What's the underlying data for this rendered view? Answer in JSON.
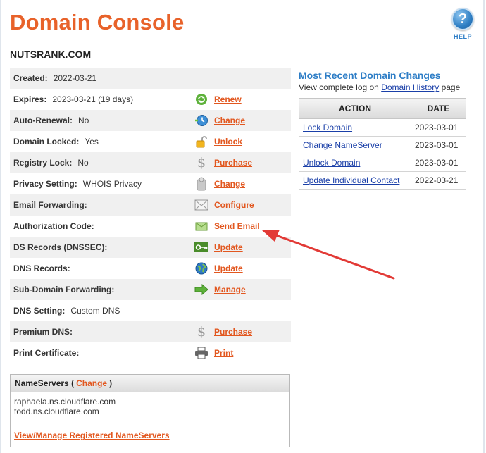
{
  "page": {
    "title": "Domain Console",
    "help_label": "HELP",
    "help_glyph": "?",
    "domain": "NUTSRANK.COM"
  },
  "info_rows": [
    {
      "label": "Created:",
      "value": "2022-03-21",
      "action": "",
      "icon": ""
    },
    {
      "label": "Expires:",
      "value": "2023-03-21 (19 days)",
      "action": "Renew",
      "icon": "renew-icon"
    },
    {
      "label": "Auto-Renewal:",
      "value": "No",
      "action": "Change",
      "icon": "clock-icon"
    },
    {
      "label": "Domain Locked:",
      "value": "Yes",
      "action": "Unlock",
      "icon": "padlock-icon"
    },
    {
      "label": "Registry Lock:",
      "value": "No",
      "action": "Purchase",
      "icon": "dollar-icon"
    },
    {
      "label": "Privacy Setting:",
      "value": "WHOIS Privacy",
      "action": "Change",
      "icon": "privacy-icon"
    },
    {
      "label": "Email Forwarding:",
      "value": "",
      "action": "Configure",
      "icon": "envelope-icon"
    },
    {
      "label": "Authorization Code:",
      "value": "",
      "action": "Send Email",
      "icon": "send-mail-icon"
    },
    {
      "label": "DS Records (DNSSEC):",
      "value": "",
      "action": "Update",
      "icon": "key-icon"
    },
    {
      "label": "DNS Records:",
      "value": "",
      "action": "Update",
      "icon": "globe-icon"
    },
    {
      "label": "Sub-Domain Forwarding:",
      "value": "",
      "action": "Manage",
      "icon": "forward-arrow-icon"
    },
    {
      "label": "DNS Setting:",
      "value": "Custom DNS",
      "action": "",
      "icon": ""
    },
    {
      "label": "Premium DNS:",
      "value": "",
      "action": "Purchase",
      "icon": "dollar-icon"
    },
    {
      "label": "Print Certificate:",
      "value": "",
      "action": "Print",
      "icon": "printer-icon"
    }
  ],
  "nameservers": {
    "heading": "NameServers",
    "open_paren": "(",
    "change_label": "Change",
    "close_paren": ")",
    "servers": [
      "raphaela.ns.cloudflare.com",
      "todd.ns.cloudflare.com"
    ],
    "manage_link": "View/Manage Registered NameServers"
  },
  "recent_changes": {
    "title": "Most Recent Domain Changes",
    "subtitle_prefix": "View complete log on",
    "history_link": "Domain History",
    "subtitle_suffix": "page",
    "columns": [
      "ACTION",
      "DATE"
    ],
    "rows": [
      {
        "action": "Lock Domain",
        "date": "2023-03-01"
      },
      {
        "action": "Change NameServer",
        "date": "2023-03-01"
      },
      {
        "action": "Unlock Domain",
        "date": "2023-03-01"
      },
      {
        "action": "Update Individual Contact",
        "date": "2022-03-21"
      }
    ]
  },
  "colors": {
    "title_orange": "#e8622a",
    "link_orange": "#e2571f",
    "heading_blue": "#2d7dc6",
    "link_blue": "#1a3fa8",
    "annotation_arrow": "#e23a36"
  }
}
